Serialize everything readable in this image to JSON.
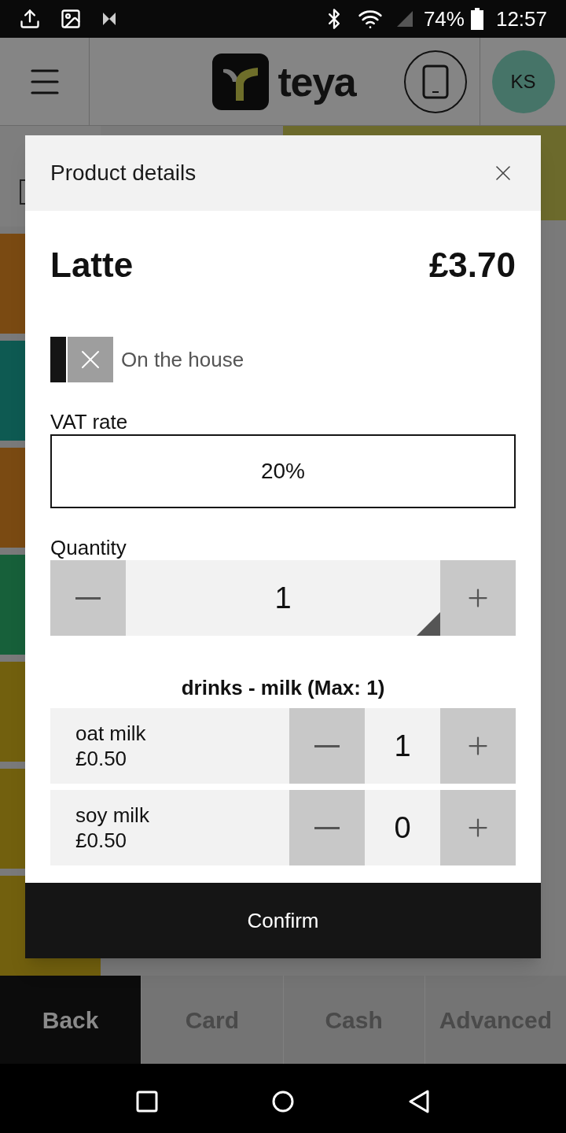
{
  "status_bar": {
    "battery": "74%",
    "time": "12:57"
  },
  "header": {
    "logo_text": "teya",
    "avatar": "KS"
  },
  "tiles": [
    {
      "color": "#7a4a12"
    },
    {
      "color": "#0e5a52"
    },
    {
      "color": "#7a4a12"
    },
    {
      "color": "#17603a"
    },
    {
      "color": "#72600e"
    },
    {
      "color": "#72600e"
    },
    {
      "color": "#72600e"
    }
  ],
  "dialog": {
    "title": "Product details",
    "product": "Latte",
    "price": "£3.70",
    "on_the_house": {
      "label": "On the house",
      "checked": false
    },
    "vat": {
      "label": "VAT rate",
      "value": "20%"
    },
    "quantity": {
      "label": "Quantity",
      "value": "1"
    },
    "modifier_group": "drinks - milk (Max: 1)",
    "modifiers": [
      {
        "name": "oat milk",
        "price": "£0.50",
        "count": "1"
      },
      {
        "name": "soy milk",
        "price": "£0.50",
        "count": "0"
      }
    ],
    "confirm": "Confirm"
  },
  "bottom_actions": [
    {
      "label": "Back",
      "selected": true
    },
    {
      "label": "Card",
      "selected": false
    },
    {
      "label": "Cash",
      "selected": false
    },
    {
      "label": "Advanced",
      "selected": false
    }
  ]
}
